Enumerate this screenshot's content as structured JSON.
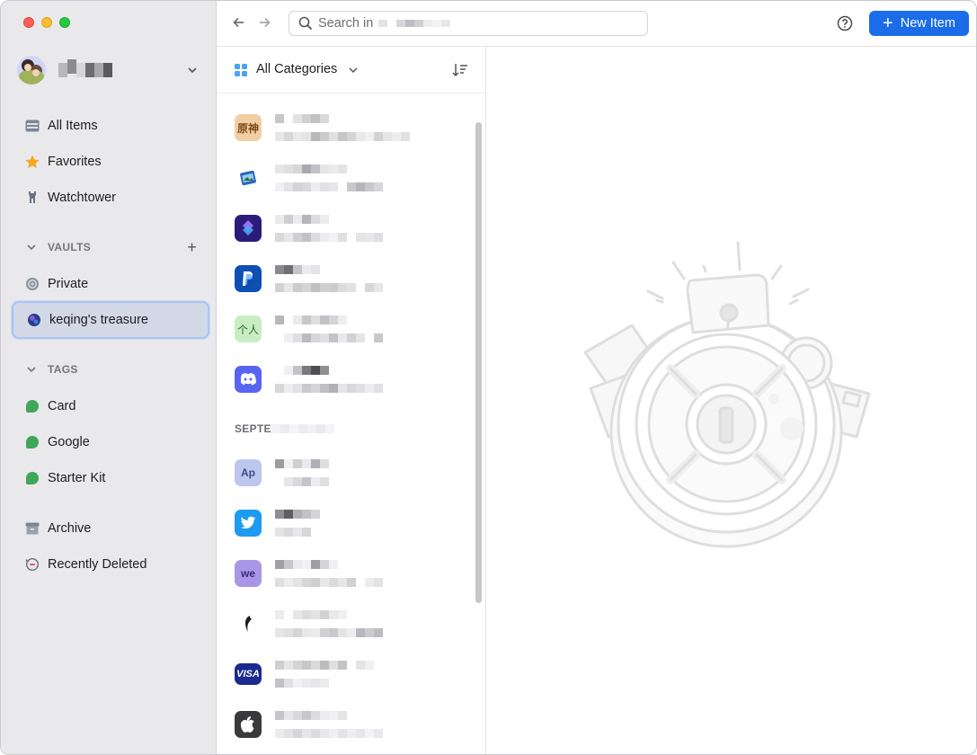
{
  "window": {
    "traffic_lights": [
      "close",
      "minimize",
      "zoom"
    ]
  },
  "sidebar": {
    "nav": [
      {
        "label": "All Items",
        "icon": "all-items-icon"
      },
      {
        "label": "Favorites",
        "icon": "star-icon"
      },
      {
        "label": "Watchtower",
        "icon": "watchtower-icon"
      }
    ],
    "vaults_header": "VAULTS",
    "vaults": [
      {
        "label": "Private",
        "icon": "vault-icon"
      },
      {
        "label": "keqing's treasure",
        "icon": "globe-vault-icon",
        "selected": true
      }
    ],
    "tags_header": "TAGS",
    "tags": [
      {
        "label": "Card"
      },
      {
        "label": "Google"
      },
      {
        "label": "Starter Kit"
      }
    ],
    "archive": "Archive",
    "recently_deleted": "Recently Deleted"
  },
  "toolbar": {
    "search_placeholder": "Search in",
    "new_item": "New Item"
  },
  "list": {
    "category": "All Categories",
    "group_label": "SEPTE",
    "items": [
      {
        "badge": "原神",
        "icon": "genshin-icon"
      },
      {
        "badge": "",
        "icon": "preview-app-icon"
      },
      {
        "badge": "",
        "icon": "stack-app-icon"
      },
      {
        "badge": "",
        "icon": "paypal-icon"
      },
      {
        "badge": "个人",
        "icon": "personal-icon"
      },
      {
        "badge": "",
        "icon": "discord-icon"
      }
    ],
    "items2": [
      {
        "badge": "Ap",
        "icon": "ap-icon"
      },
      {
        "badge": "",
        "icon": "twitter-icon"
      },
      {
        "badge": "we",
        "icon": "we-icon"
      },
      {
        "badge": "",
        "icon": "feather-icon"
      },
      {
        "badge": "VISA",
        "icon": "visa-icon"
      },
      {
        "badge": "",
        "icon": "apple-icon"
      }
    ]
  },
  "detail": {
    "illustration": "empty-vault-illustration"
  },
  "colors": {
    "accent": "#1a6ce8",
    "sidebar_bg": "#e9e9ec",
    "tag_green": "#3fa65a"
  }
}
